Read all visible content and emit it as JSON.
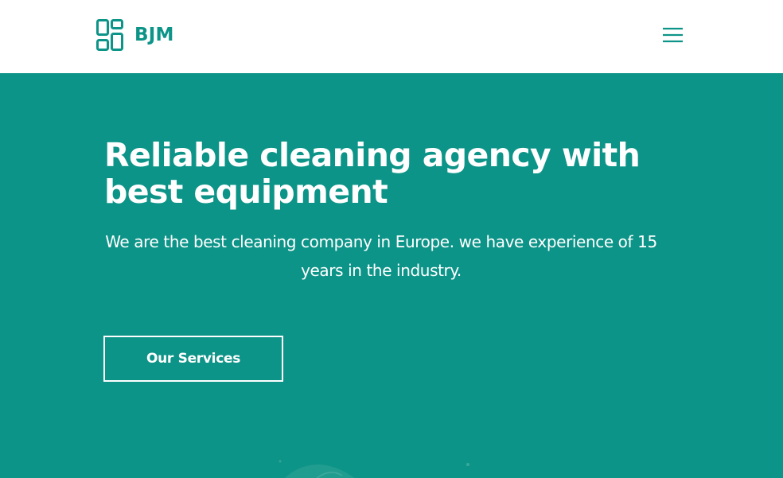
{
  "brand": {
    "name": "BJM",
    "logo_icon": "grid-logo-icon",
    "color": "#0d9488"
  },
  "nav": {
    "menu_icon": "hamburger-menu-icon"
  },
  "hero": {
    "title": "Reliable cleaning agency with best equipment",
    "subtitle": "We are the best cleaning company in Europe. we have experience of 15 years in the industry.",
    "cta_label": "Our Services",
    "background_color": "#0d9488",
    "text_color": "#ffffff"
  }
}
